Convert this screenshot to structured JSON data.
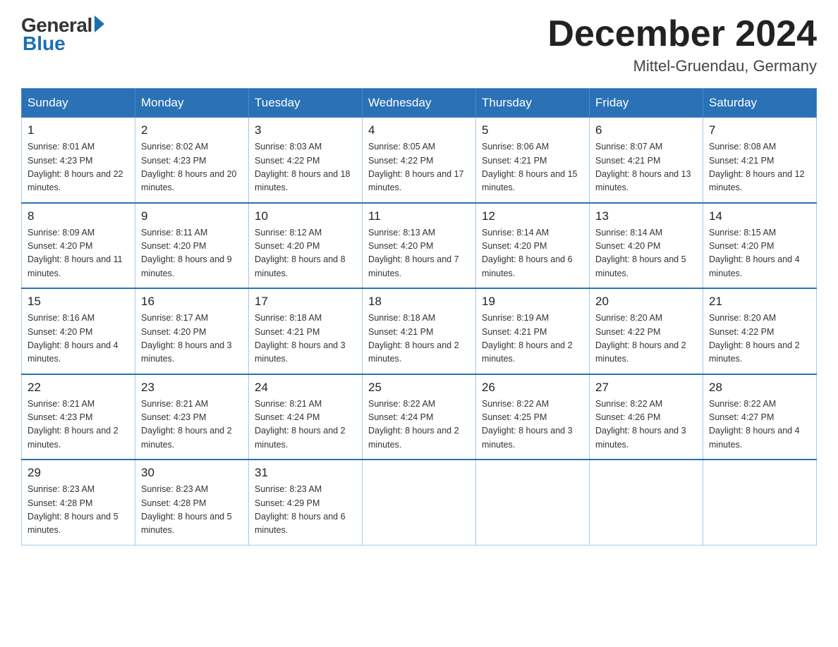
{
  "header": {
    "logo_general": "General",
    "logo_blue": "Blue",
    "month_title": "December 2024",
    "location": "Mittel-Gruendau, Germany"
  },
  "weekdays": [
    "Sunday",
    "Monday",
    "Tuesday",
    "Wednesday",
    "Thursday",
    "Friday",
    "Saturday"
  ],
  "weeks": [
    [
      {
        "day": "1",
        "sunrise": "8:01 AM",
        "sunset": "4:23 PM",
        "daylight": "8 hours and 22 minutes."
      },
      {
        "day": "2",
        "sunrise": "8:02 AM",
        "sunset": "4:23 PM",
        "daylight": "8 hours and 20 minutes."
      },
      {
        "day": "3",
        "sunrise": "8:03 AM",
        "sunset": "4:22 PM",
        "daylight": "8 hours and 18 minutes."
      },
      {
        "day": "4",
        "sunrise": "8:05 AM",
        "sunset": "4:22 PM",
        "daylight": "8 hours and 17 minutes."
      },
      {
        "day": "5",
        "sunrise": "8:06 AM",
        "sunset": "4:21 PM",
        "daylight": "8 hours and 15 minutes."
      },
      {
        "day": "6",
        "sunrise": "8:07 AM",
        "sunset": "4:21 PM",
        "daylight": "8 hours and 13 minutes."
      },
      {
        "day": "7",
        "sunrise": "8:08 AM",
        "sunset": "4:21 PM",
        "daylight": "8 hours and 12 minutes."
      }
    ],
    [
      {
        "day": "8",
        "sunrise": "8:09 AM",
        "sunset": "4:20 PM",
        "daylight": "8 hours and 11 minutes."
      },
      {
        "day": "9",
        "sunrise": "8:11 AM",
        "sunset": "4:20 PM",
        "daylight": "8 hours and 9 minutes."
      },
      {
        "day": "10",
        "sunrise": "8:12 AM",
        "sunset": "4:20 PM",
        "daylight": "8 hours and 8 minutes."
      },
      {
        "day": "11",
        "sunrise": "8:13 AM",
        "sunset": "4:20 PM",
        "daylight": "8 hours and 7 minutes."
      },
      {
        "day": "12",
        "sunrise": "8:14 AM",
        "sunset": "4:20 PM",
        "daylight": "8 hours and 6 minutes."
      },
      {
        "day": "13",
        "sunrise": "8:14 AM",
        "sunset": "4:20 PM",
        "daylight": "8 hours and 5 minutes."
      },
      {
        "day": "14",
        "sunrise": "8:15 AM",
        "sunset": "4:20 PM",
        "daylight": "8 hours and 4 minutes."
      }
    ],
    [
      {
        "day": "15",
        "sunrise": "8:16 AM",
        "sunset": "4:20 PM",
        "daylight": "8 hours and 4 minutes."
      },
      {
        "day": "16",
        "sunrise": "8:17 AM",
        "sunset": "4:20 PM",
        "daylight": "8 hours and 3 minutes."
      },
      {
        "day": "17",
        "sunrise": "8:18 AM",
        "sunset": "4:21 PM",
        "daylight": "8 hours and 3 minutes."
      },
      {
        "day": "18",
        "sunrise": "8:18 AM",
        "sunset": "4:21 PM",
        "daylight": "8 hours and 2 minutes."
      },
      {
        "day": "19",
        "sunrise": "8:19 AM",
        "sunset": "4:21 PM",
        "daylight": "8 hours and 2 minutes."
      },
      {
        "day": "20",
        "sunrise": "8:20 AM",
        "sunset": "4:22 PM",
        "daylight": "8 hours and 2 minutes."
      },
      {
        "day": "21",
        "sunrise": "8:20 AM",
        "sunset": "4:22 PM",
        "daylight": "8 hours and 2 minutes."
      }
    ],
    [
      {
        "day": "22",
        "sunrise": "8:21 AM",
        "sunset": "4:23 PM",
        "daylight": "8 hours and 2 minutes."
      },
      {
        "day": "23",
        "sunrise": "8:21 AM",
        "sunset": "4:23 PM",
        "daylight": "8 hours and 2 minutes."
      },
      {
        "day": "24",
        "sunrise": "8:21 AM",
        "sunset": "4:24 PM",
        "daylight": "8 hours and 2 minutes."
      },
      {
        "day": "25",
        "sunrise": "8:22 AM",
        "sunset": "4:24 PM",
        "daylight": "8 hours and 2 minutes."
      },
      {
        "day": "26",
        "sunrise": "8:22 AM",
        "sunset": "4:25 PM",
        "daylight": "8 hours and 3 minutes."
      },
      {
        "day": "27",
        "sunrise": "8:22 AM",
        "sunset": "4:26 PM",
        "daylight": "8 hours and 3 minutes."
      },
      {
        "day": "28",
        "sunrise": "8:22 AM",
        "sunset": "4:27 PM",
        "daylight": "8 hours and 4 minutes."
      }
    ],
    [
      {
        "day": "29",
        "sunrise": "8:23 AM",
        "sunset": "4:28 PM",
        "daylight": "8 hours and 5 minutes."
      },
      {
        "day": "30",
        "sunrise": "8:23 AM",
        "sunset": "4:28 PM",
        "daylight": "8 hours and 5 minutes."
      },
      {
        "day": "31",
        "sunrise": "8:23 AM",
        "sunset": "4:29 PM",
        "daylight": "8 hours and 6 minutes."
      },
      null,
      null,
      null,
      null
    ]
  ]
}
